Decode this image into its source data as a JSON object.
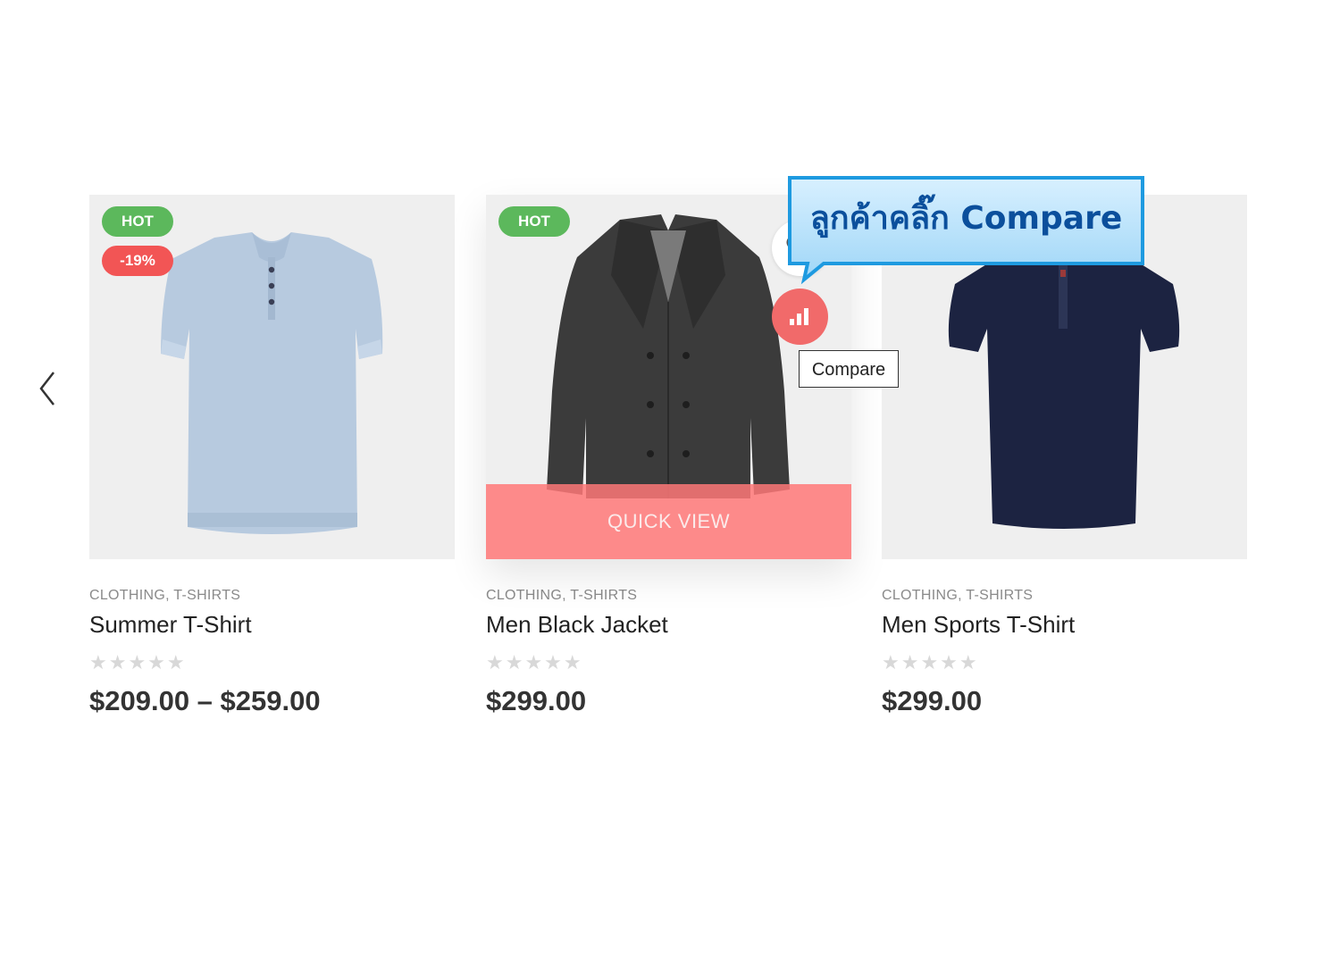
{
  "carousel": {
    "prev_icon": "chevron-left-icon"
  },
  "products": [
    {
      "badges": [
        "HOT",
        "-19%"
      ],
      "categories": [
        "CLOTHING",
        "T-SHIRTS"
      ],
      "title": "Summer T-Shirt",
      "rating": 0,
      "price": "$209.00 – $259.00",
      "colors": {
        "shirt": "#b7cadf"
      }
    },
    {
      "badges": [
        "HOT"
      ],
      "categories": [
        "CLOTHING",
        "T-SHIRTS"
      ],
      "title": "Men Black Jacket",
      "rating": 0,
      "price": "$299.00",
      "quick_view_label": "QUICK VIEW",
      "colors": {
        "jacket": "#3b3b3b"
      }
    },
    {
      "badges": [],
      "categories": [
        "CLOTHING",
        "T-SHIRTS"
      ],
      "title": "Men Sports T-Shirt",
      "rating": 0,
      "price": "$299.00",
      "colors": {
        "shirt": "#1c2341"
      }
    }
  ],
  "hover_actions": {
    "compare_icon": "bar-chart-icon",
    "tooltip": "Compare",
    "wishlist_icon": "heart-icon"
  },
  "annotation": {
    "text": "ลูกค้าคลิ๊ก Compare"
  },
  "theme": {
    "hot_badge": "#5cb85c",
    "sale_badge": "#f25555",
    "accent": "#f16a6a"
  }
}
